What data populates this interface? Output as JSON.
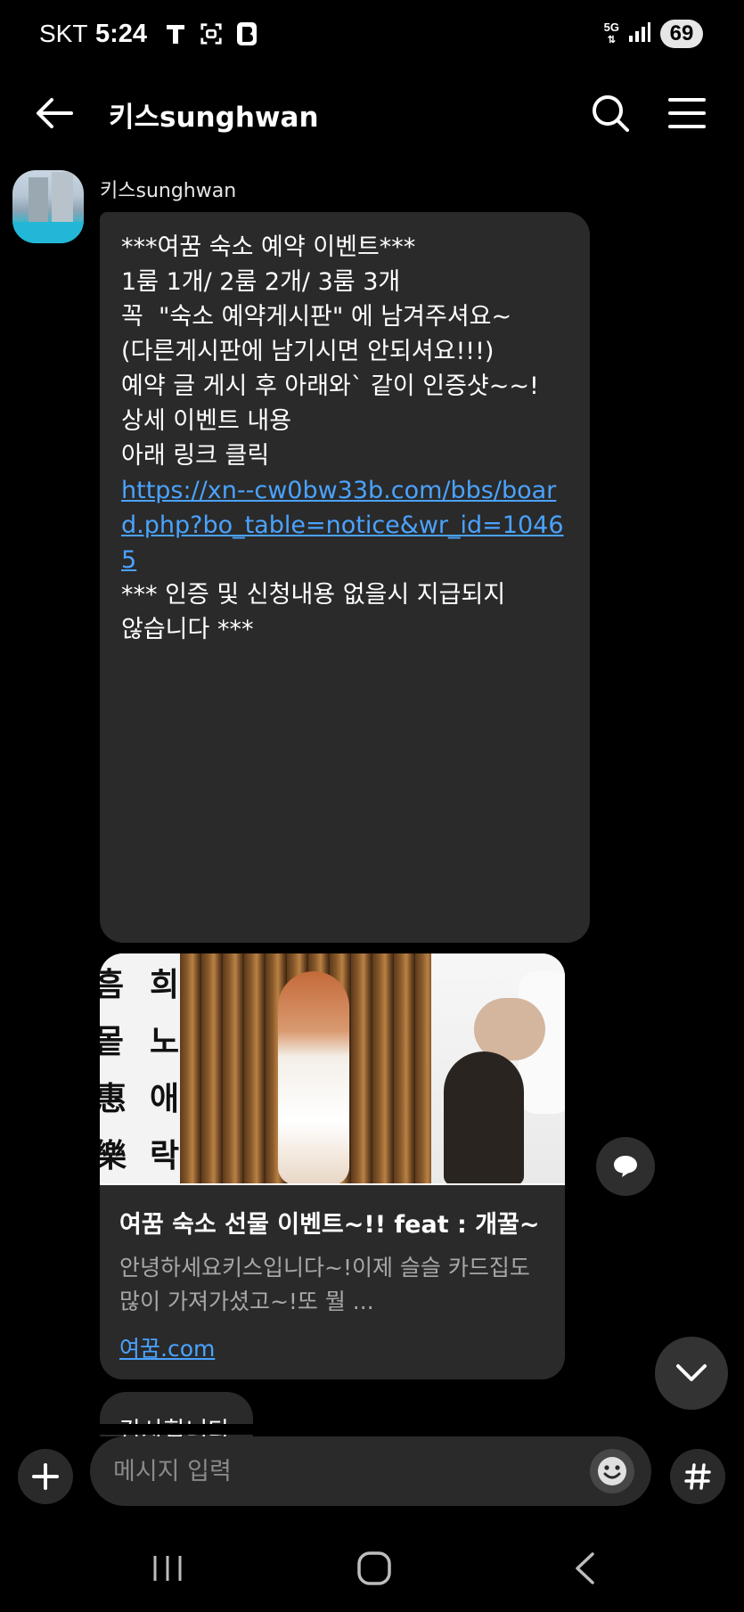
{
  "status_bar": {
    "carrier": "SKT",
    "time": "5:24",
    "left_icons": [
      "t-icon",
      "scan-icon",
      "b-icon"
    ],
    "network": "5G",
    "battery": "69"
  },
  "header": {
    "title": "키스sunghwan",
    "back_icon": "arrow-left-icon",
    "search_icon": "search-icon",
    "menu_icon": "hamburger-menu-icon"
  },
  "chat": {
    "sender_name": "키스sunghwan",
    "message": {
      "lines": [
        "***여꿈 숙소 예약 이벤트***",
        "",
        "",
        "1룸 1개/ 2룸 2개/ 3룸 3개",
        "",
        "꼭  \"숙소 예약게시판\" 에 남겨주셔요~",
        "(다른게시판에 남기시면 안되셔요!!!)",
        "",
        "예약 글 게시 후 아래와` 같이 인증샷~~!",
        "",
        "상세 이벤트 내용",
        "",
        "아래 링크 클릭",
        ""
      ],
      "link": "https://xn--cw0bw33b.com/bbs/board.php?bo_table=notice&wr_id=10465",
      "footer_lines": [
        "",
        "*** 인증 및 신청내용 없을시 지급되지",
        "않습니다 ***"
      ]
    },
    "link_card": {
      "calligraphy_chars": [
        "흠",
        "희",
        "뫁",
        "노",
        "惠",
        "애",
        "樂",
        "락"
      ],
      "title": "여꿈 숙소 선물 이벤트~!! feat : 개꿀~",
      "description": "안녕하세요키스입니다~!이제 슬슬 카드집도 많이 가져가셨고~!또 뭘 ...",
      "domain": "여꿈.com"
    },
    "partial_message": "감사합니다"
  },
  "composer": {
    "placeholder": "메시지 입력",
    "plus_icon": "plus-icon",
    "emoji_icon": "emoji-icon",
    "hash_icon": "hashtag-icon"
  },
  "nav_bar": {
    "recent_icon": "recent-apps-icon",
    "home_icon": "home-icon",
    "back_icon": "nav-back-icon"
  },
  "colors": {
    "background": "#000000",
    "bubble": "#2a2a2a",
    "link": "#4aa3ff",
    "secondary_text": "#a8a8a8"
  }
}
